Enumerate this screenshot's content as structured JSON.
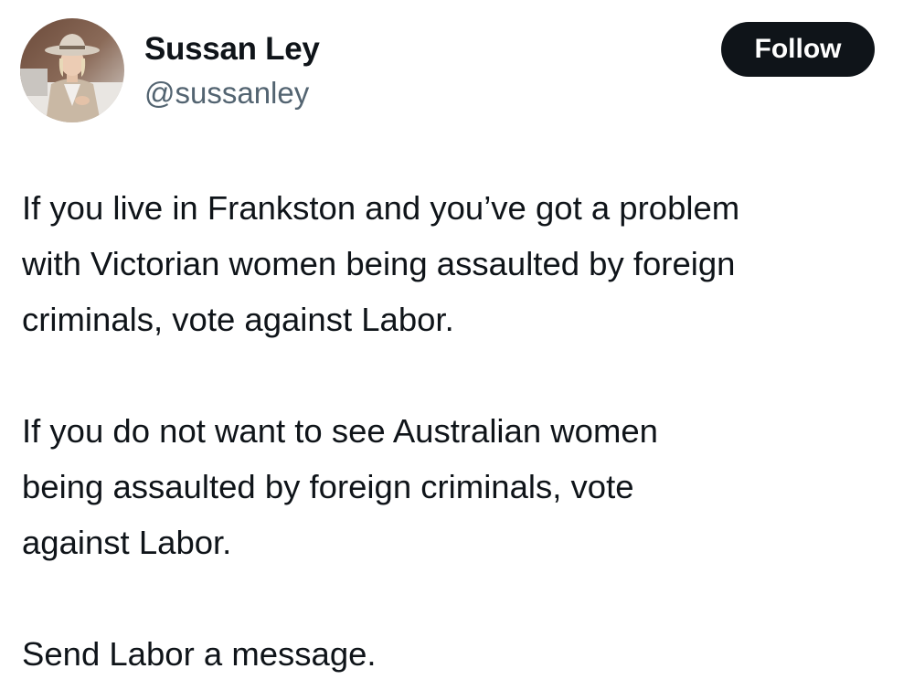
{
  "author": {
    "name": "Sussan Ley",
    "handle": "@sussanley",
    "avatar": "profile-photo-woman-in-hat"
  },
  "follow_button": {
    "label": "Follow"
  },
  "tweet": {
    "paragraphs": [
      "If you live in Frankston and you’ve got a problem\nwith Victorian women being assaulted by foreign\ncriminals, vote against Labor.",
      "If you do not want to see Australian women\nbeing assaulted by foreign criminals, vote\nagainst Labor.",
      "Send Labor a message."
    ]
  },
  "colors": {
    "text_primary": "#0f1419",
    "text_secondary": "#536471",
    "button_bg": "#0f1419",
    "button_text": "#ffffff",
    "background": "#ffffff"
  }
}
